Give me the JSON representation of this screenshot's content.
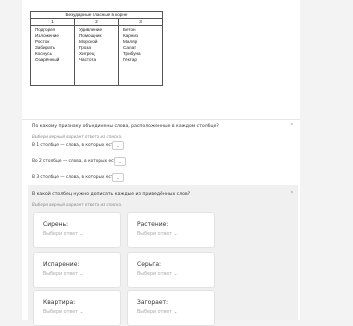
{
  "table": {
    "header": "Безударные гласные в корне",
    "columns": [
      "1",
      "2",
      "3"
    ],
    "words": [
      [
        "Подгорел",
        "Изложение",
        "Росток",
        "Забирать",
        "Коснусь",
        "Озарённый"
      ],
      [
        "Удивление",
        "Помощник",
        "Морской",
        "Гроза",
        "Хитрец",
        "Частота"
      ],
      [
        "Бетон",
        "Карниз",
        "Маляр",
        "Салат",
        "Трибуна",
        "Гектар"
      ]
    ]
  },
  "question1": {
    "text": "По какому признаку объединены слова, расположенные в каждом столбце?",
    "hint": "Выбери верный вариант ответа из списка.",
    "rows": [
      {
        "label": "В 1 столбце — слова, в которых есть"
      },
      {
        "label": "Во 2 столбце — слова, в которых есть"
      },
      {
        "label": "В 3 столбце — слова, в которых есть"
      }
    ],
    "chevron": "⌃",
    "dropdown_icon": "⌄"
  },
  "question2": {
    "text": "В какой столбец нужно дописать каждые из приведённых слов?",
    "hint": "Выбери верный вариант ответа из списка.",
    "chevron": "⌃",
    "cards": [
      {
        "label": "Сирень:",
        "placeholder": "Выбери ответ ⌄"
      },
      {
        "label": "Растение:",
        "placeholder": "Выбери ответ ⌄"
      },
      {
        "label": "Испарение:",
        "placeholder": "Выбери ответ ⌄"
      },
      {
        "label": "Серьга:",
        "placeholder": "Выбери ответ ⌄"
      },
      {
        "label": "Квартира:",
        "placeholder": "Выбери ответ ⌄"
      },
      {
        "label": "Загорает:",
        "placeholder": "Выбери ответ ⌄"
      }
    ]
  }
}
